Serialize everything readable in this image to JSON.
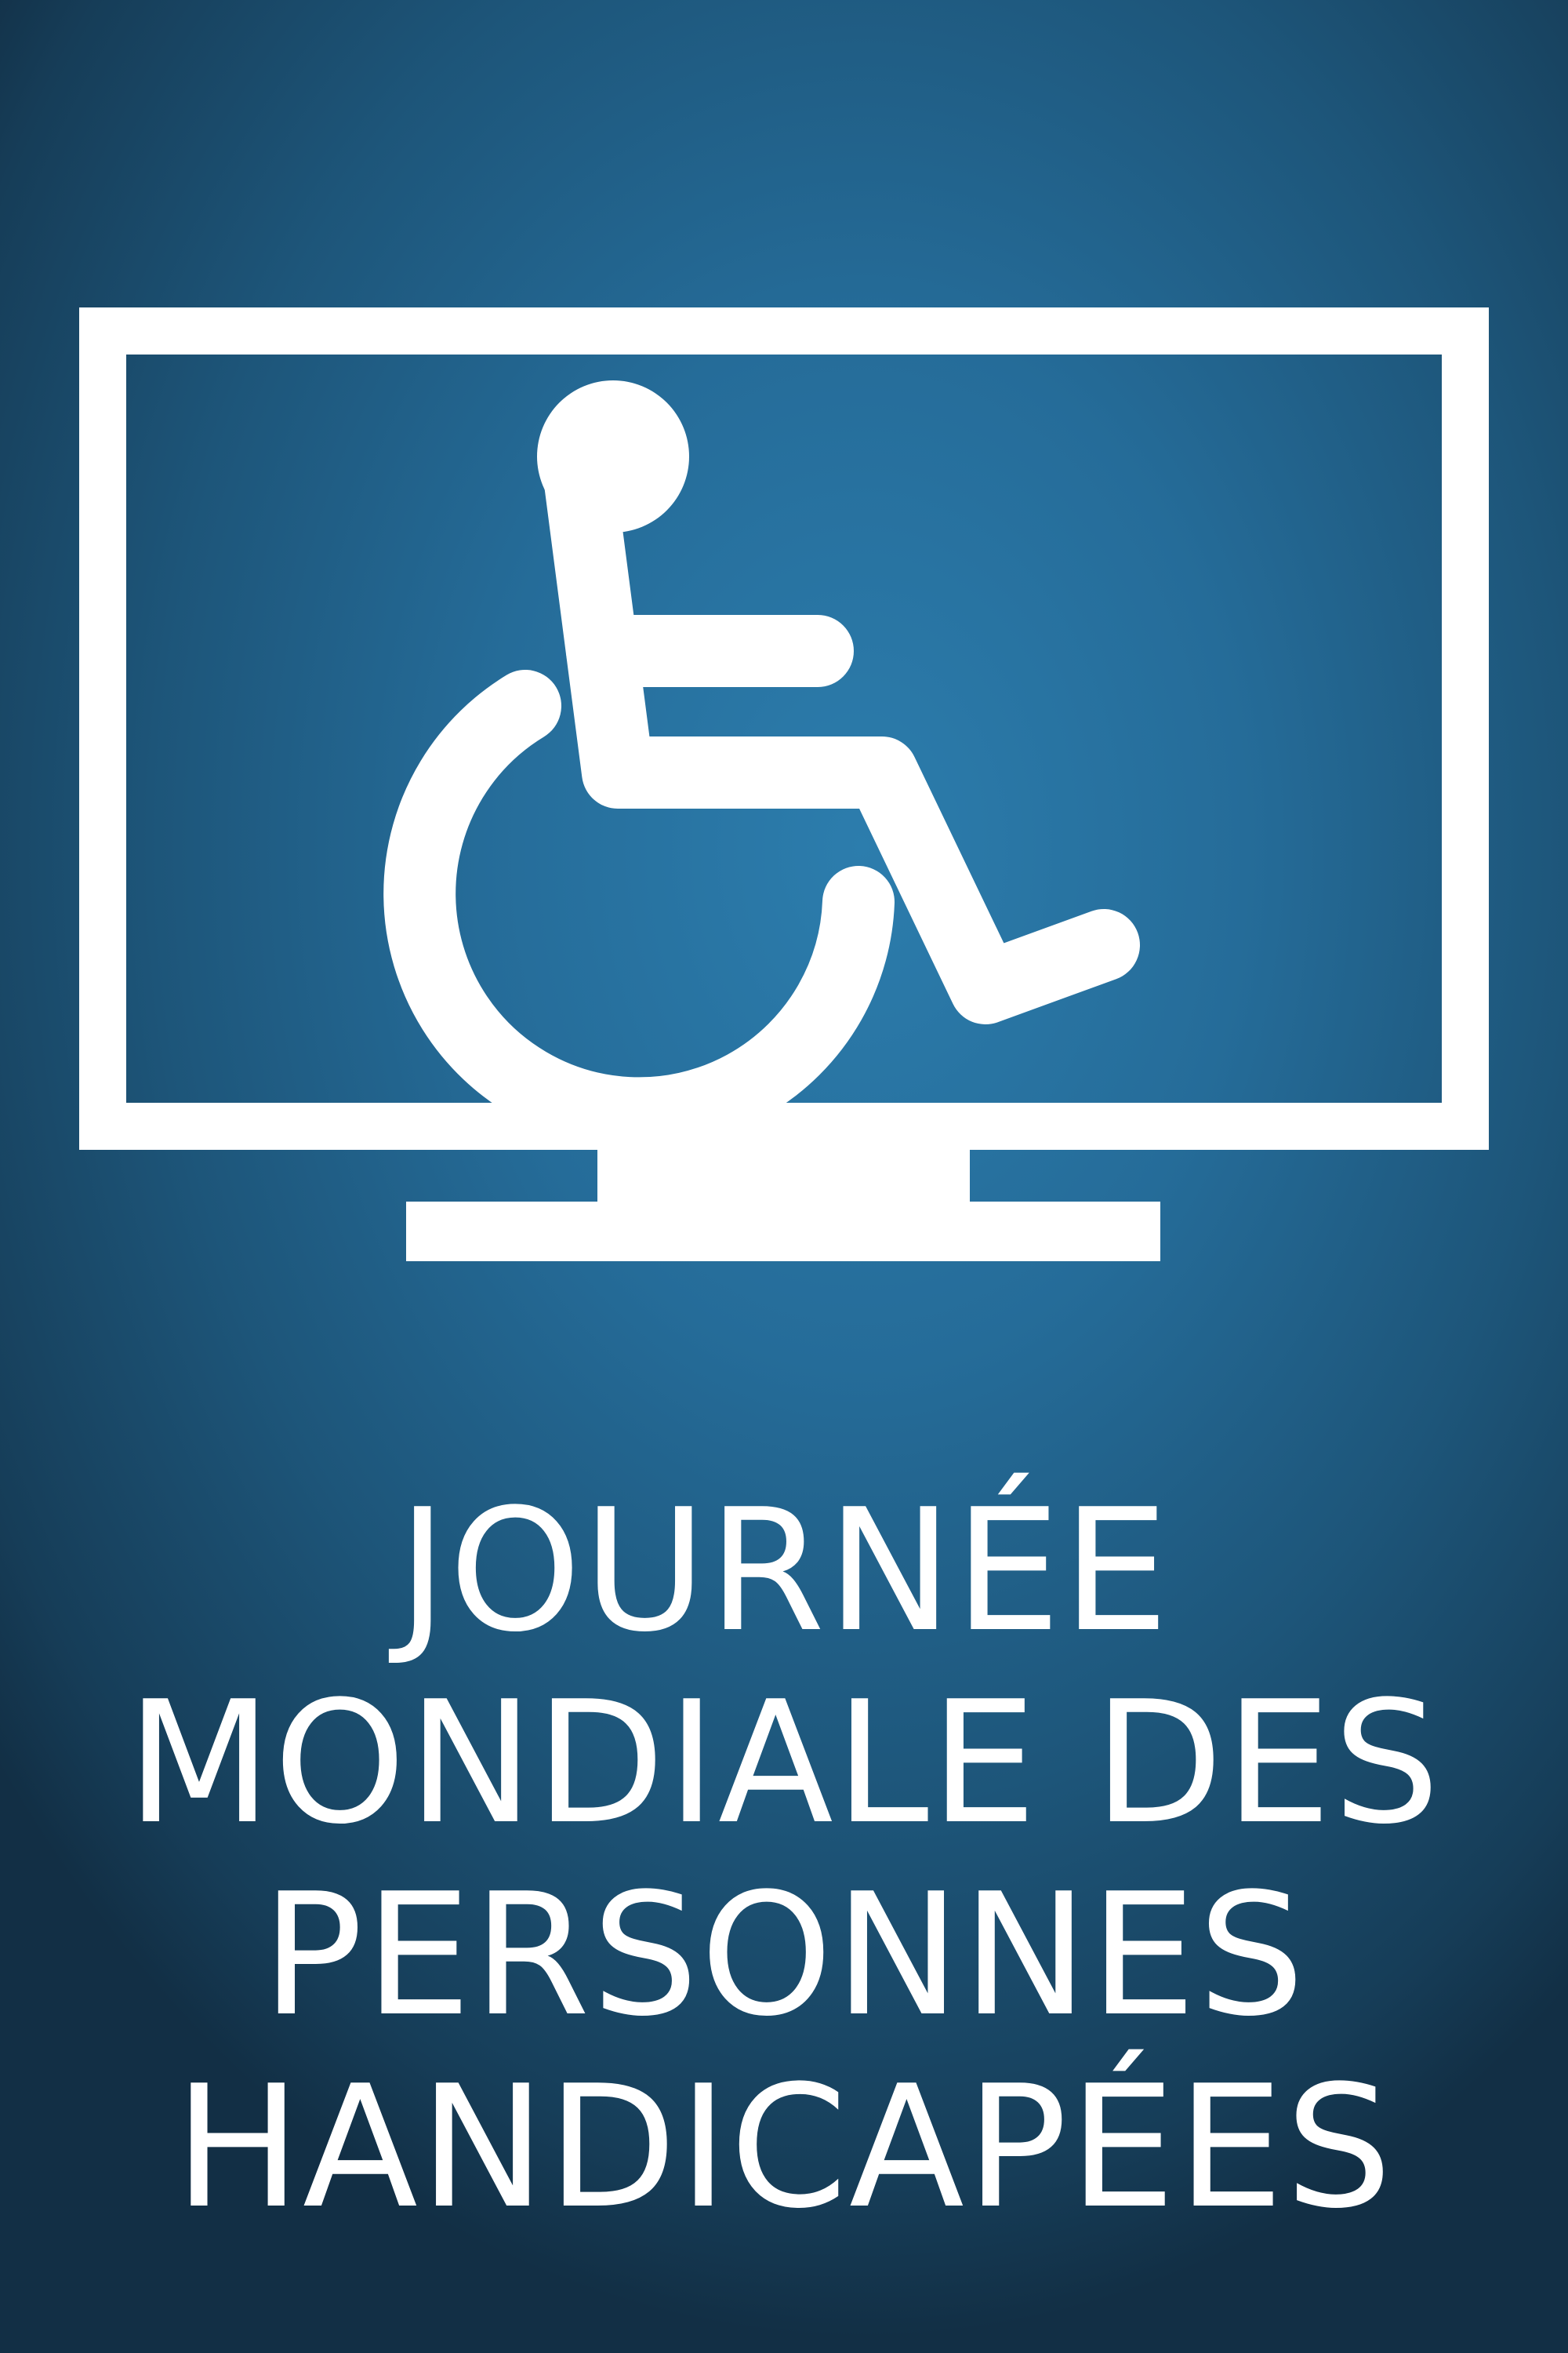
{
  "poster": {
    "title_lines": [
      "JOURNÉE",
      "MONDIALE DES",
      "PERSONNES",
      "HANDICAPÉES"
    ]
  },
  "colors": {
    "background_center": "#2c7dad",
    "background_edge": "#122f45",
    "foreground": "#ffffff"
  },
  "icons": {
    "monitor": "monitor-icon",
    "wheelchair": "wheelchair-accessibility-icon"
  }
}
